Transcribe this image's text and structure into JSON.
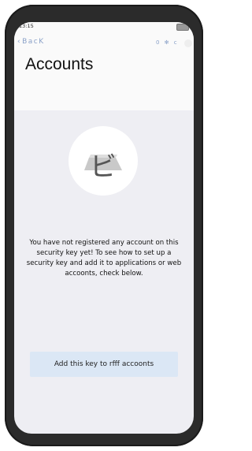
{
  "status_bar": {
    "time": "13:15"
  },
  "header": {
    "back_label": "BacK",
    "right_label": "0 ✻ c",
    "title": "Accounts"
  },
  "main": {
    "emblem_glyph": "ビ",
    "message": "You have not registered any account on this security key yet! To see how to set up a security key and add it to applications or web accoonts, check below.",
    "add_button_label": "Add this key to rfff accoonts"
  },
  "colors": {
    "accent": "#8aa1c8",
    "button_bg": "#dbe7f5",
    "screen_bg": "#eeeef3"
  }
}
